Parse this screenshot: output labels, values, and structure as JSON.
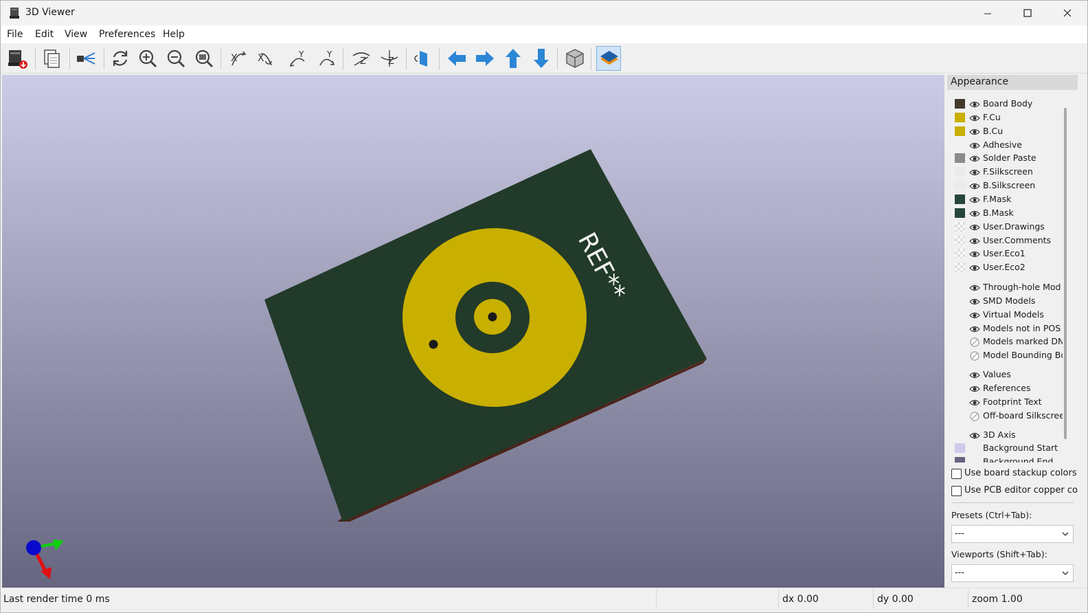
{
  "window": {
    "title": "3D Viewer"
  },
  "menu": [
    "File",
    "Edit",
    "View",
    "Preferences",
    "Help"
  ],
  "toolbar": {
    "icons": [
      "export-icon",
      "copy-icon",
      "raytrace-icon",
      "reload-icon",
      "zoom-in-icon",
      "zoom-out-icon",
      "zoom-fit-icon",
      "rotate-x-cw-icon",
      "rotate-x-ccw-icon",
      "rotate-y-cw-icon",
      "rotate-y-ccw-icon",
      "rotate-z-cw-icon",
      "rotate-z-ccw-icon",
      "flip-board-icon",
      "pan-left-icon",
      "pan-right-icon",
      "pan-up-icon",
      "pan-down-icon",
      "orthographic-icon",
      "layers-manager-icon"
    ],
    "active": "layers-manager-icon"
  },
  "viewport": {
    "silkscreen_text": "REF**",
    "background_top": "#cccce6",
    "background_bottom": "#666680",
    "board_color": "#223a29",
    "copper_color": "#c8af00",
    "axis_colors": {
      "x": "#e01010",
      "y": "#10d010",
      "z": "#0a0acc"
    }
  },
  "appearance": {
    "title": "Appearance",
    "layers": [
      {
        "name": "Board Body",
        "swatch": "#433a2c"
      },
      {
        "name": "F.Cu",
        "swatch": "#c8af00"
      },
      {
        "name": "B.Cu",
        "swatch": "#c8af00"
      },
      {
        "name": "Adhesive",
        "swatch": ""
      },
      {
        "name": "Solder Paste",
        "swatch": "#8a8a8a"
      },
      {
        "name": "F.Silkscreen",
        "swatch": "#ebebeb"
      },
      {
        "name": "B.Silkscreen",
        "swatch": "#ebebeb"
      },
      {
        "name": "F.Mask",
        "swatch": "#27463a"
      },
      {
        "name": "B.Mask",
        "swatch": "#27463a"
      },
      {
        "name": "User.Drawings",
        "swatch": "checker"
      },
      {
        "name": "User.Comments",
        "swatch": "checker"
      },
      {
        "name": "User.Eco1",
        "swatch": "checker"
      },
      {
        "name": "User.Eco2",
        "swatch": "checker"
      }
    ],
    "models": [
      {
        "name": "Through-hole Mod",
        "visible": true
      },
      {
        "name": "SMD Models",
        "visible": true
      },
      {
        "name": "Virtual Models",
        "visible": true
      },
      {
        "name": "Models not in POS",
        "visible": true
      },
      {
        "name": "Models marked DN",
        "visible": false
      },
      {
        "name": "Model Bounding Bo",
        "visible": false
      }
    ],
    "objects": [
      {
        "name": "Values",
        "visible": true
      },
      {
        "name": "References",
        "visible": true
      },
      {
        "name": "Footprint Text",
        "visible": true
      },
      {
        "name": "Off-board Silkscree",
        "visible": false
      }
    ],
    "extras": [
      {
        "name": "3D Axis",
        "swatch": "",
        "eye": true
      },
      {
        "name": "Background Start",
        "swatch": "#ccccea",
        "eye": false
      },
      {
        "name": "Background End",
        "swatch": "#666680",
        "eye": false
      }
    ],
    "options": [
      "Use board stackup colors",
      "Use PCB editor copper colo"
    ],
    "presets_label": "Presets (Ctrl+Tab):",
    "presets_value": "---",
    "viewports_label": "Viewports (Shift+Tab):",
    "viewports_value": "---"
  },
  "status": {
    "render_time": "Last render time 0 ms",
    "dx": "dx 0.00",
    "dy": "dy 0.00",
    "zoom": "zoom 1.00"
  }
}
